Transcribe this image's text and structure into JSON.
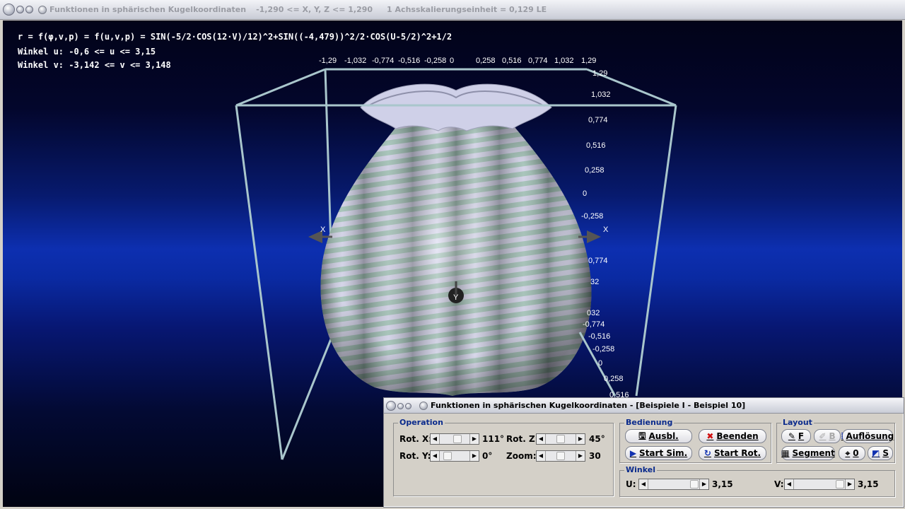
{
  "window": {
    "title": "Funktionen in sphärischen Kugelkoordinaten",
    "range": "-1,290 <= X, Y, Z <= 1,290",
    "scale": "1 Achsskalierungseinheit = 0,129 LE"
  },
  "info": {
    "formula": "r = f(φ,v,p) = f(u,v,p) = SIN(-5/2·COS(12·V)/12)^2+SIN((-4,479))^2/2·COS(U-5/2)^2+1/2",
    "winkel_u": "Winkel u: -0,6 <= u <= 3,15",
    "winkel_v": "Winkel v: -3,142 <= v <= 3,148"
  },
  "axes": {
    "x_ticks_top": [
      "-1,29",
      "-1,032",
      "-0,774",
      "-0,516",
      "-0,258",
      "0",
      "0,258",
      "0,516",
      "0,774",
      "1,032",
      "1,29"
    ],
    "right_ticks_upper": [
      "1,29",
      "1,032",
      "0,774",
      "0,516",
      "0,258",
      "0",
      "-0,258"
    ],
    "right_ticks_lower": [
      "0,774",
      "32",
      "032",
      "-0,774",
      "-0,516",
      "-0,258",
      "0",
      "0,258",
      "0,516"
    ],
    "x_label_left": "X",
    "x_label_right": "X",
    "y_label": "Y"
  },
  "colors": {
    "stripe_light": "#d9d9f2",
    "stripe_green": "#a9cbbf",
    "box_edge": "#a9c6cc",
    "group_title": "#0a2a8c"
  },
  "dialog": {
    "title": "Funktionen in sphärischen Kugelkoordinaten - [Beispiele I - Beispiel 10]",
    "operation": {
      "title": "Operation",
      "rot_x_label": "Rot. X:",
      "rot_x_value": "111°",
      "rot_y_label": "Rot. Y:",
      "rot_y_value": "0°",
      "rot_z_label": "Rot. Z:",
      "rot_z_value": "45°",
      "zoom_label": "Zoom:",
      "zoom_value": "30"
    },
    "bedienung": {
      "title": "Bedienung",
      "ausbl": "Ausbl.",
      "beenden": "Beenden",
      "start_sim": "Start Sim.",
      "start_rot": "Start Rot."
    },
    "layout": {
      "title": "Layout",
      "f": "F",
      "b": "B",
      "aufloesung": "Auflösung",
      "segment": "Segment",
      "o": "0",
      "s": "S"
    },
    "winkel": {
      "title": "Winkel",
      "u_label": "U:",
      "u_value": "3,15",
      "v_label": "V:",
      "v_value": "3,15"
    }
  }
}
